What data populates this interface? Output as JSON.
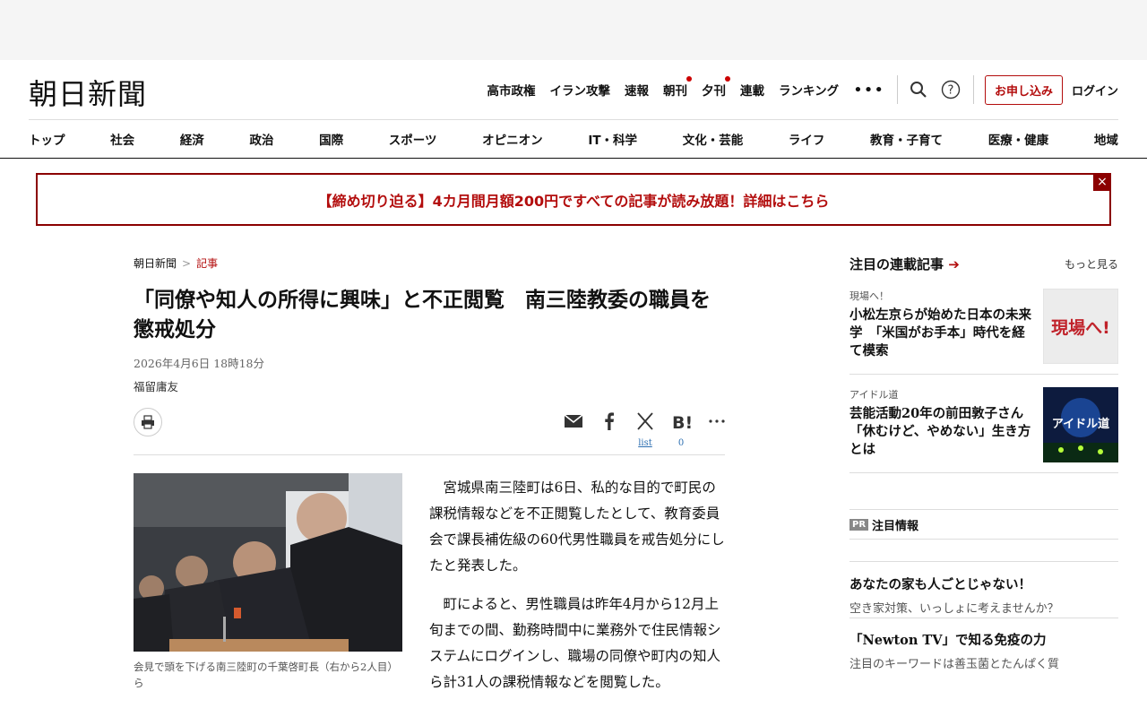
{
  "logo": "朝日新聞",
  "topnav": {
    "items": [
      "高市政権",
      "イラン攻撃",
      "速報",
      "朝刊",
      "夕刊",
      "連載",
      "ランキング"
    ],
    "more": "•••",
    "subscribe": "お申し込み",
    "login": "ログイン"
  },
  "categories": [
    "トップ",
    "社会",
    "経済",
    "政治",
    "国際",
    "スポーツ",
    "オピニオン",
    "IT・科学",
    "文化・芸能",
    "ライフ",
    "教育・子育て",
    "医療・健康",
    "地域"
  ],
  "banner": {
    "text": "【締め切り迫る】4カ月間月額200円ですべての記事が読み放題！詳細はこちら",
    "close": "×"
  },
  "breadcrumb": {
    "home": "朝日新聞",
    "sep": ">",
    "current": "記事"
  },
  "article": {
    "headline": "「同僚や知人の所得に興味」と不正閲覧　南三陸教委の職員を懲戒処分",
    "date": "2026年4月6日 18時18分",
    "author": "福留庸友",
    "share": {
      "x_count": "list",
      "hatena_count": "0"
    },
    "caption": "会見で頭を下げる南三陸町の千葉啓町長（右から2人目）ら",
    "paragraphs": [
      "宮城県南三陸町は6日、私的な目的で町民の課税情報などを不正閲覧したとして、教育委員会で課長補佐級の60代男性職員を戒告処分にしたと発表した。",
      "町によると、男性職員は昨年4月から12月上旬までの間、勤務時間中に業務外で住民情報システムにログインし、職場の同僚や町内の知人ら計31人の課税情報などを閲覧した。"
    ]
  },
  "sidebar": {
    "title": "注目の連載記事",
    "arrow": "➔",
    "more": "もっと見る",
    "items": [
      {
        "tag": "現場へ！",
        "title": "小松左京らが始めた日本の未来学　「米国がお手本」時代を経て模索",
        "thumb_text": "現場へ!"
      },
      {
        "tag": "アイドル道",
        "title": "芸能活動20年の前田敦子さん「休むけど、やめない」生き方とは",
        "thumb_text": "アイドル道"
      }
    ],
    "pr_badge": "PR",
    "pr_label": "注目情報",
    "ads": [
      {
        "title": "あなたの家も人ごとじゃない！",
        "desc": "空き家対策、いっしょに考えませんか？"
      },
      {
        "title": "「Newton TV」で知る免疫の力",
        "desc": "注目のキーワードは善玉菌とたんぱく質"
      }
    ]
  }
}
